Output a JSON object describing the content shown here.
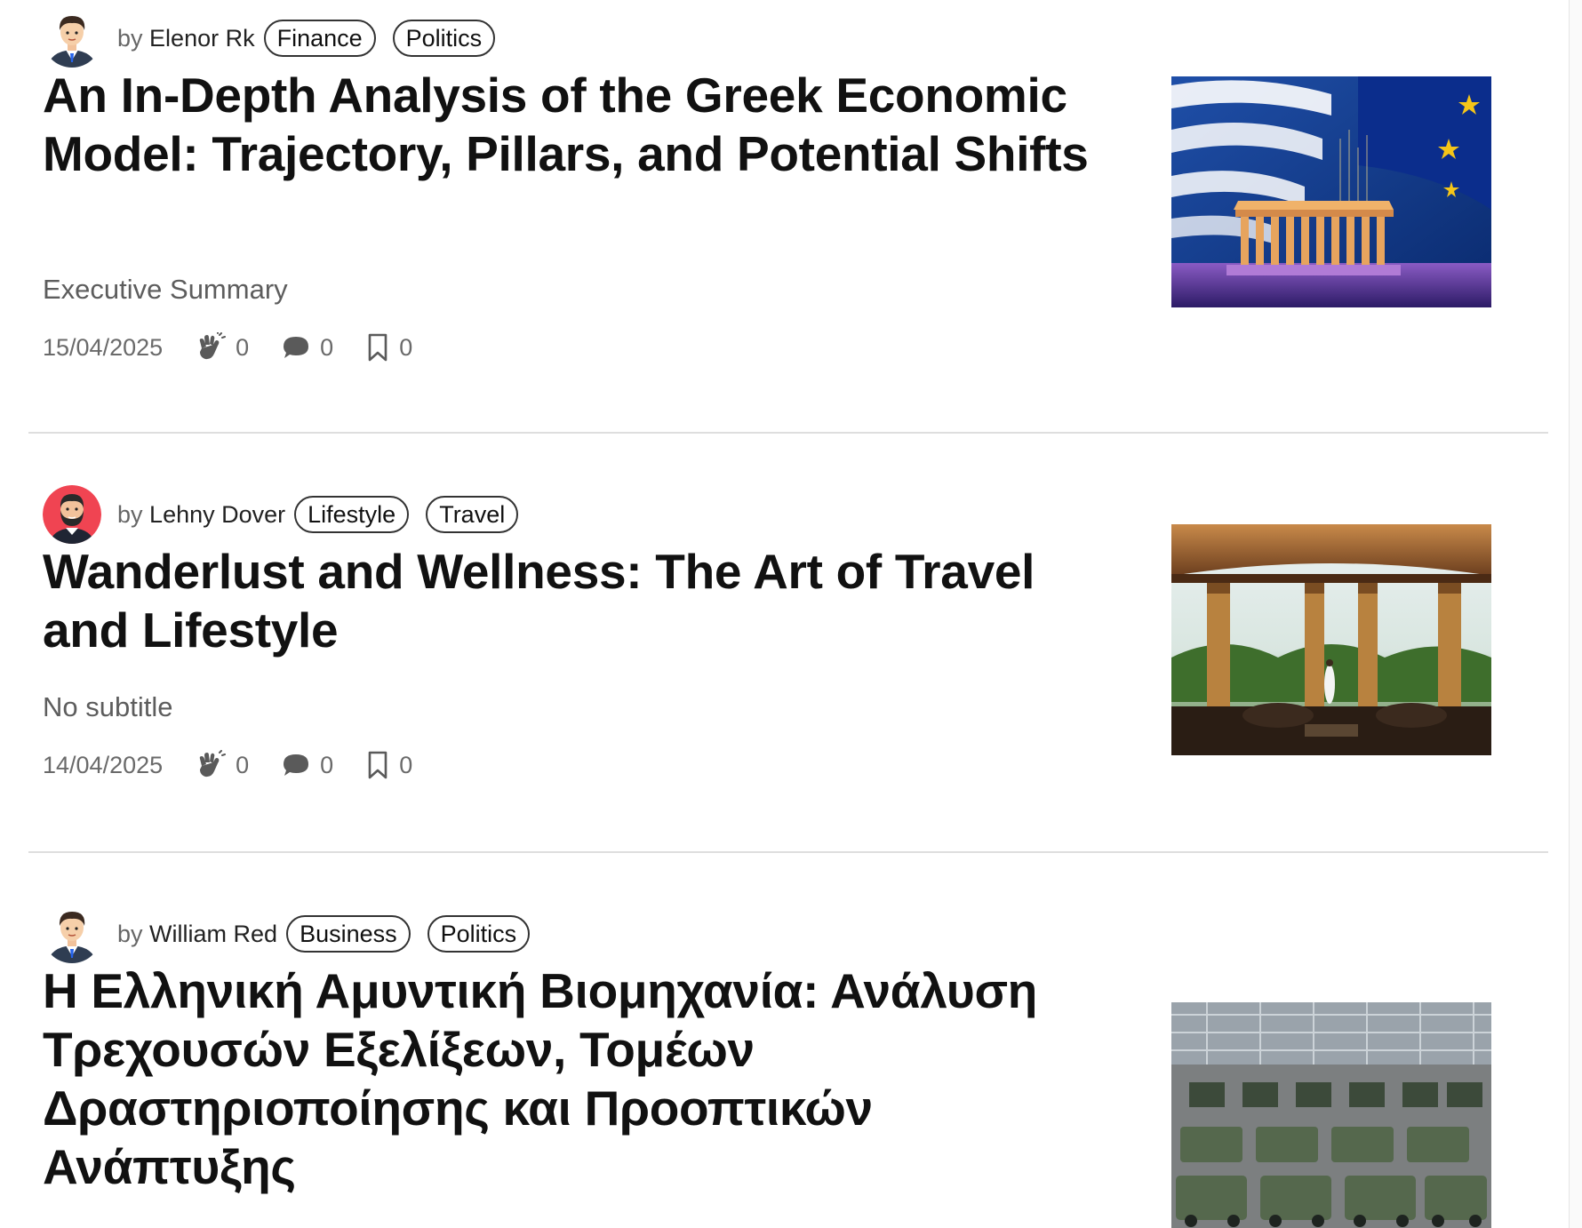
{
  "articles": [
    {
      "author_prefix": "by",
      "author": "Elenor Rk",
      "tags": [
        "Finance",
        "Politics"
      ],
      "title": "An In-Depth Analysis of the Greek Economic Model: Trajectory, Pillars, and Potential Shifts",
      "subtitle": "Executive Summary",
      "date": "15/04/2025",
      "claps": "0",
      "comments": "0",
      "bookmarks": "0",
      "avatar_icon": "man-avatar-icon",
      "thumbnail": "greek-flag-parthenon-image"
    },
    {
      "author_prefix": "by",
      "author": "Lehny Dover",
      "tags": [
        "Lifestyle",
        "Travel"
      ],
      "title": "Wanderlust and Wellness: The Art of Travel and Lifestyle",
      "subtitle": "No subtitle",
      "date": "14/04/2025",
      "claps": "0",
      "comments": "0",
      "bookmarks": "0",
      "avatar_icon": "bearded-man-avatar-icon",
      "thumbnail": "pavilion-view-image"
    },
    {
      "author_prefix": "by",
      "author": "William Red",
      "tags": [
        "Business",
        "Politics"
      ],
      "title": "Η Ελληνική Αμυντική Βιομηχανία: Ανάλυση Τρεχουσών Εξελίξεων, Τομέων Δραστηριοποίησης και Προοπτικών Ανάπτυξης",
      "avatar_icon": "man-avatar-icon",
      "thumbnail": "military-factory-image"
    }
  ],
  "icons": {
    "clap": "clap-icon",
    "comment": "comment-icon",
    "bookmark": "bookmark-icon"
  },
  "colors": {
    "tag_border": "#333333",
    "divider": "#dedede",
    "muted_text": "#6a6a6a"
  }
}
